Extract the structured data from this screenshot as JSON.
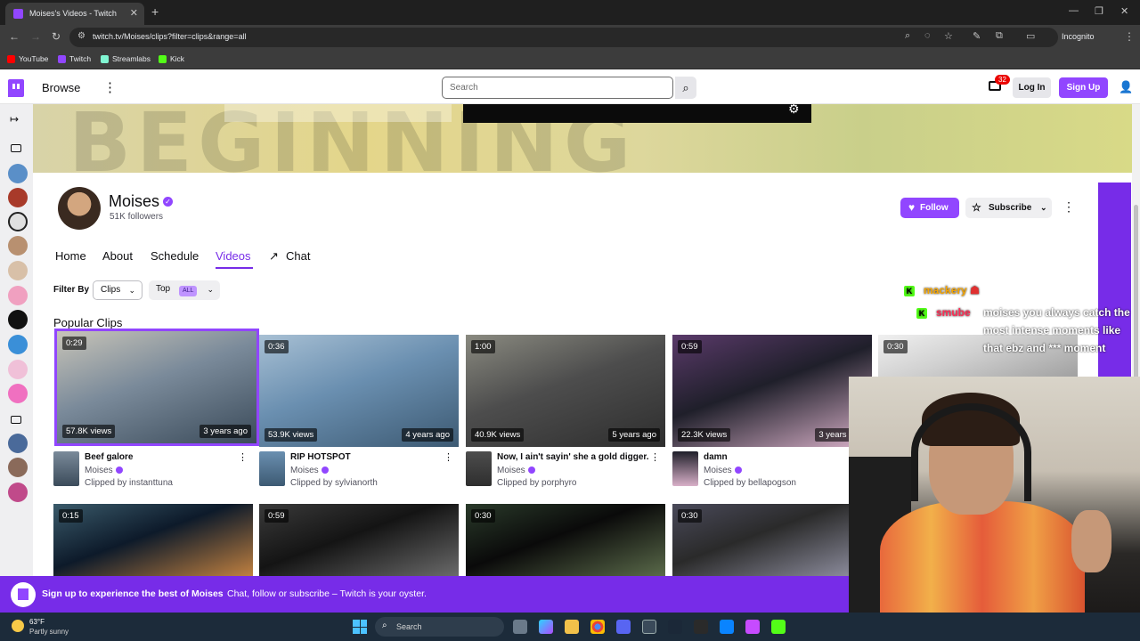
{
  "browser": {
    "tab_title": "Moises's Videos - Twitch",
    "url": "twitch.tv/Moises/clips?filter=clips&range=all",
    "incognito_label": "Incognito",
    "bookmarks": [
      {
        "label": "YouTube",
        "color": "#ff0000"
      },
      {
        "label": "Twitch",
        "color": "#9146ff"
      },
      {
        "label": "Streamlabs",
        "color": "#80f5d2"
      },
      {
        "label": "Kick",
        "color": "#53fc18"
      }
    ]
  },
  "topnav": {
    "browse": "Browse",
    "search_placeholder": "Search",
    "inbox_count": "32",
    "login": "Log In",
    "signup": "Sign Up"
  },
  "channel": {
    "name": "Moises",
    "followers": "51K followers",
    "follow": "Follow",
    "subscribe": "Subscribe",
    "tabs": [
      "Home",
      "About",
      "Schedule",
      "Videos",
      "Chat"
    ],
    "active_tab": "Videos"
  },
  "filters": {
    "label": "Filter By",
    "type": "Clips",
    "sort": "Top",
    "range_badge": "ALL"
  },
  "section_title": "Popular Clips",
  "clips": [
    {
      "duration": "0:29",
      "views": "57.8K views",
      "age": "3 years ago",
      "title": "Beef galore",
      "author": "Moises",
      "clipper": "Clipped by instanttuna",
      "colors": [
        "#7a8a9a",
        "#c8c4b8",
        "#3b4b5a"
      ]
    },
    {
      "duration": "0:36",
      "views": "53.9K views",
      "age": "4 years ago",
      "title": "RIP HOTSPOT",
      "author": "Moises",
      "clipper": "Clipped by sylvianorth",
      "colors": [
        "#6a8fb0",
        "#a8c0d4",
        "#3d5a73"
      ]
    },
    {
      "duration": "1:00",
      "views": "40.9K views",
      "age": "5 years ago",
      "title": "Now, I ain't sayin' she a gold digger...",
      "author": "Moises",
      "clipper": "Clipped by porphyro",
      "colors": [
        "#4d4d4d",
        "#8a8a80",
        "#2e2e2e"
      ]
    },
    {
      "duration": "0:59",
      "views": "22.3K views",
      "age": "3 years ago",
      "title": "damn",
      "author": "Moises",
      "clipper": "Clipped by bellapogson",
      "colors": [
        "#1f1f2a",
        "#5a3a6a",
        "#d8b0c8"
      ]
    },
    {
      "duration": "0:30",
      "views": "",
      "age": "",
      "title": "",
      "author": "",
      "clipper": "",
      "colors": [
        "#d0d0d0",
        "#f0f0f0",
        "#a0a0a0"
      ]
    },
    {
      "duration": "0:15",
      "views": "",
      "age": "",
      "title": "",
      "author": "",
      "clipper": "",
      "colors": [
        "#0d1a2a",
        "#3a5a6a",
        "#c08040"
      ]
    },
    {
      "duration": "0:59",
      "views": "",
      "age": "",
      "title": "",
      "author": "",
      "clipper": "",
      "colors": [
        "#141414",
        "#3a3a3a",
        "#6a6a6a"
      ]
    },
    {
      "duration": "0:30",
      "views": "",
      "age": "",
      "title": "",
      "author": "",
      "clipper": "",
      "colors": [
        "#0a0a0a",
        "#2a3a2a",
        "#5a6a4a"
      ]
    },
    {
      "duration": "0:30",
      "views": "",
      "age": "",
      "title": "",
      "author": "",
      "clipper": "",
      "colors": [
        "#2a2a2a",
        "#4a4a5a",
        "#8a8a9a"
      ]
    }
  ],
  "overlay_chat": [
    {
      "user": "mackery",
      "user_color": "#f7a600",
      "message": ""
    },
    {
      "user": "smube",
      "user_color": "#ff2d55",
      "message": "moises you always catch the most intense moments like that ebz and *** moment"
    }
  ],
  "signup_banner": {
    "headline": "Sign up to experience the best of Moises",
    "sub": "Chat, follow or subscribe – Twitch is your oyster."
  },
  "taskbar": {
    "temperature": "63°F",
    "condition": "Partly sunny",
    "search_placeholder": "Search"
  }
}
